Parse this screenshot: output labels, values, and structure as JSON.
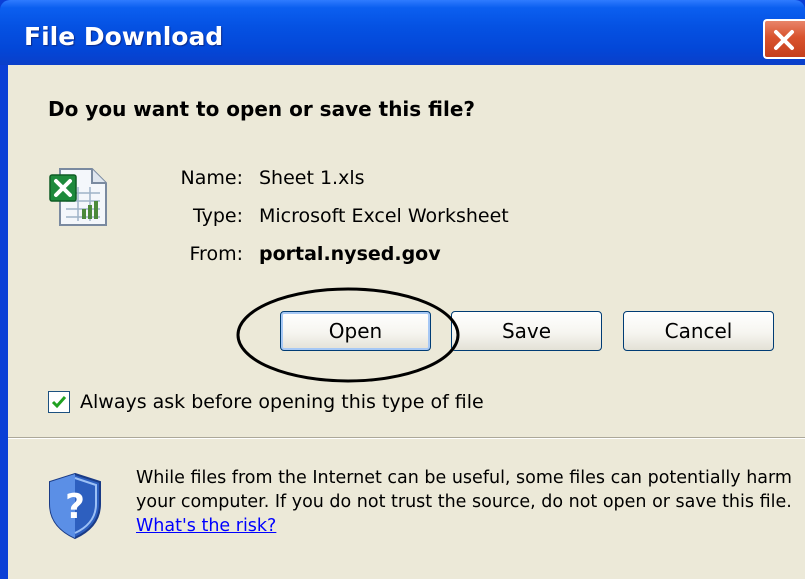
{
  "window": {
    "title": "File Download",
    "close_icon": "close-icon"
  },
  "dialog": {
    "question": "Do you want to open or save this file?",
    "file_icon": "excel-file-icon",
    "fields": {
      "name_label": "Name:",
      "name_value": "Sheet 1.xls",
      "type_label": "Type:",
      "type_value": "Microsoft Excel Worksheet",
      "from_label": "From:",
      "from_value": "portal.nysed.gov"
    },
    "buttons": {
      "open": "Open",
      "save": "Save",
      "cancel": "Cancel"
    },
    "always_ask": {
      "label": "Always ask before opening this type of file",
      "checked": true
    },
    "warning": {
      "icon": "security-shield-icon",
      "text": "While files from the Internet can be useful, some files can potentially harm your computer. If you do not trust the source, do not open or save this file.",
      "link": "What's the risk?"
    }
  },
  "annotation": {
    "shape": "ellipse",
    "target": "Open"
  },
  "colors": {
    "titlebar": "#0552e3",
    "client_bg": "#ece9d8",
    "button_border": "#003c74",
    "close_button": "#d9532e",
    "link": "#0000ff"
  }
}
